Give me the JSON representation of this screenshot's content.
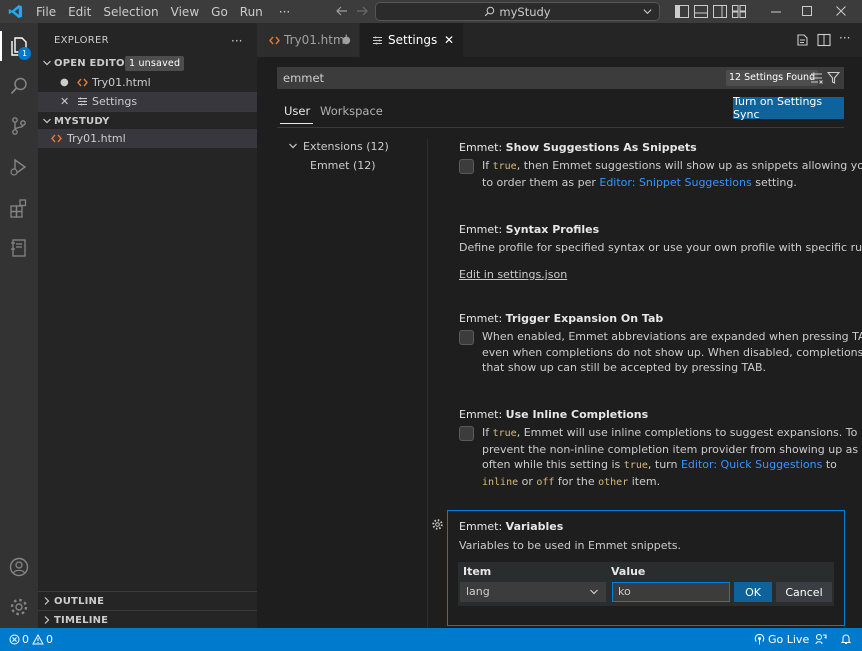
{
  "titlebar": {
    "menu": [
      "File",
      "Edit",
      "Selection",
      "View",
      "Go",
      "Run",
      "···"
    ],
    "search": "myStudy"
  },
  "activity": {
    "explorer_badge": "1"
  },
  "sidebar": {
    "title": "EXPLORER",
    "more": "···",
    "open_editors": {
      "label": "OPEN EDITORS",
      "badge": "1 unsaved"
    },
    "open_files": [
      {
        "name": "Try01.html",
        "marker": "●"
      },
      {
        "name": "Settings",
        "marker": "✕"
      }
    ],
    "folder": "MYSTUDY",
    "folder_files": [
      "Try01.html"
    ],
    "outline": "OUTLINE",
    "timeline": "TIMELINE"
  },
  "tabs": [
    {
      "label": "Try01.html",
      "marker": "●"
    },
    {
      "label": "Settings",
      "marker": "✕"
    }
  ],
  "settings": {
    "search_value": "emmet",
    "found": "12 Settings Found",
    "scope_tabs": [
      "User",
      "Workspace"
    ],
    "sync_button": "Turn on Settings Sync",
    "toc": {
      "group": "Extensions (12)",
      "item": "Emmet (12)"
    },
    "items": [
      {
        "prefix": "Emmet: ",
        "title": "Show Suggestions As Snippets",
        "d1": "If ",
        "code1": "true",
        "d2": ", then Emmet suggestions will show up as snippets allowing you",
        "d3": "to order them as per ",
        "link": "Editor: Snippet Suggestions",
        "d4": " setting."
      },
      {
        "prefix": "Emmet: ",
        "title": "Syntax Profiles",
        "desc": "Define profile for specified syntax or use your own profile with specific rules.",
        "link": "Edit in settings.json"
      },
      {
        "prefix": "Emmet: ",
        "title": "Trigger Expansion On Tab",
        "lines": [
          "When enabled, Emmet abbreviations are expanded when pressing TAB,",
          "even when completions do not show up. When disabled, completions",
          "that show up can still be accepted by pressing TAB."
        ]
      },
      {
        "prefix": "Emmet: ",
        "title": "Use Inline Completions",
        "l1a": "If ",
        "l1code": "true",
        "l1b": ", Emmet will use inline completions to suggest expansions. To",
        "l2": "prevent the non-inline completion item provider from showing up as",
        "l3a": "often while this setting is ",
        "l3code": "true",
        "l3b": ", turn ",
        "l3link": "Editor: Quick Suggestions",
        "l3c": " to",
        "l4code1": "inline",
        "l4a": " or ",
        "l4code2": "off",
        "l4b": " for the ",
        "l4code3": "other",
        "l4c": " item."
      },
      {
        "prefix": "Emmet: ",
        "title": "Variables",
        "desc": "Variables to be used in Emmet snippets.",
        "col_item": "Item",
        "col_value": "Value",
        "item_value": "lang",
        "value_value": "ko",
        "ok": "OK",
        "cancel": "Cancel"
      }
    ]
  },
  "status": {
    "errors": "0",
    "warnings": "0",
    "golive": "Go Live"
  },
  "colors": {
    "accent": "#007acc",
    "sync": "#0e639c",
    "link": "#3794ff",
    "code": "#d7ba7d"
  }
}
